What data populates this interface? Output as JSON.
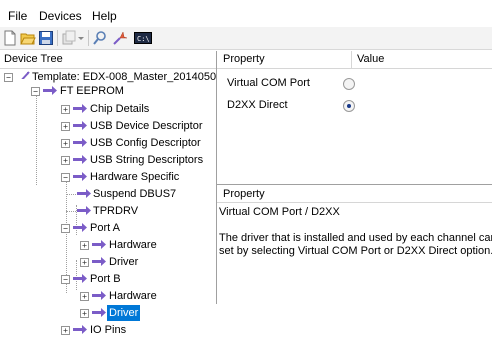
{
  "menu": {
    "file": "File",
    "devices": "Devices",
    "help": "Help"
  },
  "toolbar": {
    "icons": [
      "new-doc-icon",
      "open-folder-icon",
      "save-icon",
      "copy-icon",
      "dropdown-icon",
      "search-icon",
      "program-icon",
      "cmd-icon"
    ],
    "cmd_label": "C:\\"
  },
  "tree": {
    "header": "Device Tree",
    "root": "Template: EDX-008_Master_2014050",
    "ft_eeprom": "FT EEPROM",
    "chip_details": "Chip Details",
    "usb_device_descriptor": "USB Device Descriptor",
    "usb_config_descriptor": "USB Config Descriptor",
    "usb_string_descriptors": "USB String Descriptors",
    "hardware_specific": "Hardware Specific",
    "suspend_dbus7": "Suspend DBUS7",
    "tprdrv": "TPRDRV",
    "port_a": "Port A",
    "port_a_hardware": "Hardware",
    "port_a_driver": "Driver",
    "port_b": "Port B",
    "port_b_hardware": "Hardware",
    "port_b_driver": "Driver",
    "io_pins": "IO Pins"
  },
  "properties": {
    "col_property": "Property",
    "col_value": "Value",
    "rows": [
      {
        "name": "Virtual COM Port",
        "selected": false
      },
      {
        "name": "D2XX Direct",
        "selected": true
      }
    ]
  },
  "description": {
    "header": "Property",
    "title": "Virtual COM Port / D2XX",
    "line1": "The driver that is installed and used by each channel can",
    "line2": "set by selecting Virtual COM Port or D2XX Direct option."
  },
  "colors": {
    "selection": "#0078d7",
    "radio_dot": "#1a3a8a",
    "arrow": "#7b5cc7"
  }
}
